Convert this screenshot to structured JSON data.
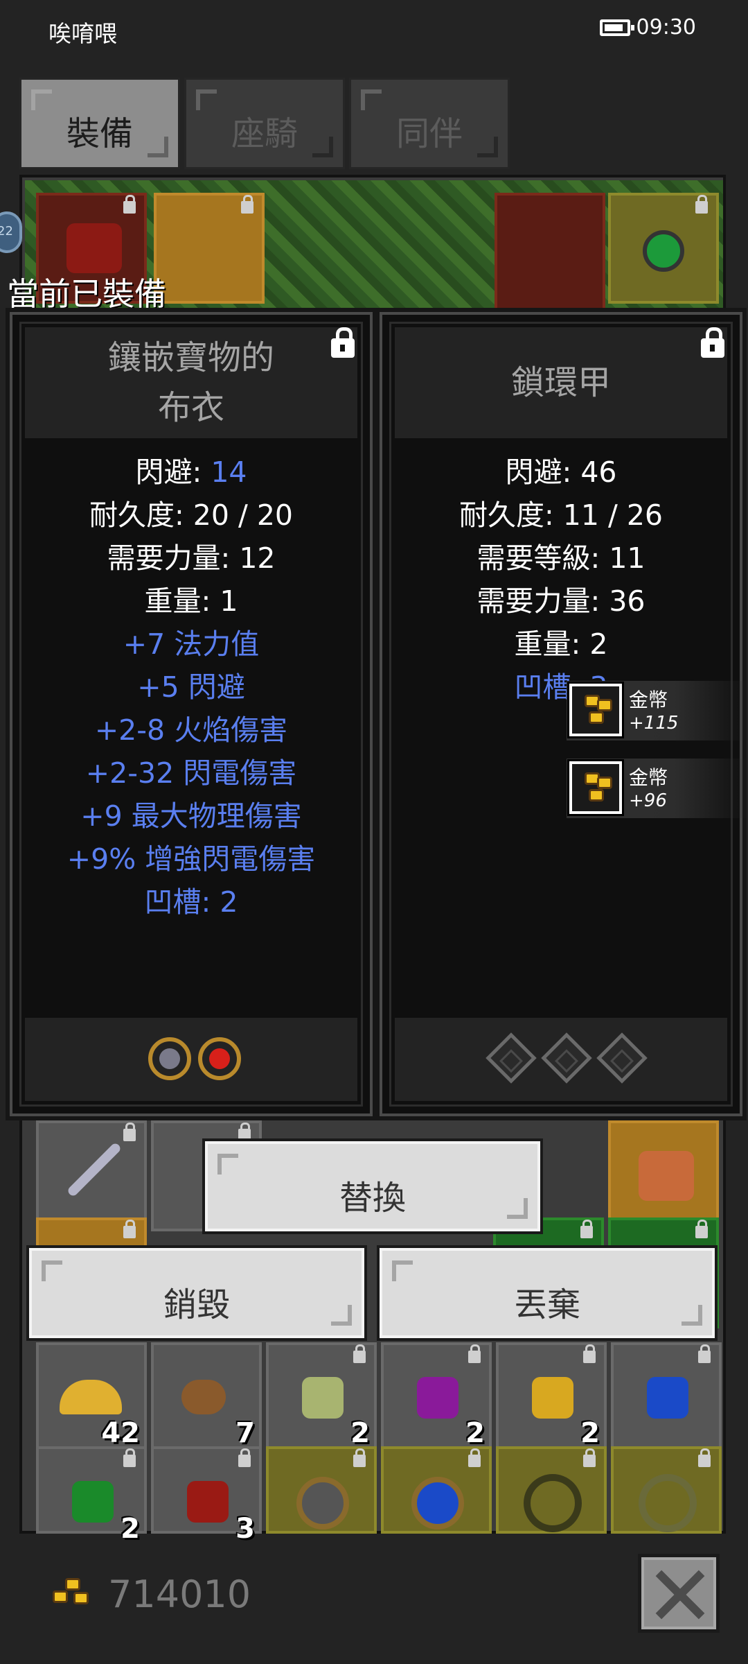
{
  "status_bar": {
    "carrier": "唉唷喂",
    "time": "09:30",
    "battery_level": 0.7
  },
  "tabs": [
    {
      "label": "裝備",
      "active": true
    },
    {
      "label": "座騎",
      "active": false
    },
    {
      "label": "同伴",
      "active": false
    }
  ],
  "side_orb_text": "22",
  "equipped_label": "當前已裝備",
  "cards": [
    {
      "name_line1": "鑲嵌寶物的",
      "name_line2": "布衣",
      "locked": true,
      "stats": [
        {
          "label": "閃避: ",
          "value": "14",
          "value_color": "blue"
        },
        {
          "label": "耐久度: 20 / 20"
        },
        {
          "label": "需要力量: 12"
        },
        {
          "label": "重量: 1"
        }
      ],
      "mods": [
        "+7 法力值",
        "+5 閃避",
        "+2-8 火焰傷害",
        "+2-32 閃電傷害",
        "+9 最大物理傷害",
        "+9% 增強閃電傷害",
        "凹槽: 2"
      ],
      "sockets": [
        "gray-gem-icon",
        "red-gem-icon"
      ]
    },
    {
      "name_line1": "鎖環甲",
      "locked": true,
      "stats": [
        {
          "label": "閃避: 46"
        },
        {
          "label": "耐久度: 11 / 26"
        },
        {
          "label": "需要等級: 11"
        },
        {
          "label": "需要力量: 36"
        },
        {
          "label": "重量: 2"
        }
      ],
      "mods": [
        "凹槽: 3"
      ],
      "sockets": [
        "empty-socket-icon",
        "empty-socket-icon",
        "empty-socket-icon"
      ]
    }
  ],
  "notifications": [
    {
      "title": "金幣",
      "value": "+115"
    },
    {
      "title": "金幣",
      "value": "+96"
    }
  ],
  "actions": {
    "replace": "替換",
    "destroy": "銷毀",
    "discard": "丟棄"
  },
  "inventory_counts": [
    "42",
    "7",
    "2",
    "2",
    "2"
  ],
  "partial_counts": [
    "2",
    "3"
  ],
  "gold": "714010",
  "colors": {
    "blue_text": "#5a7ff0",
    "gold": "#f0c020"
  }
}
